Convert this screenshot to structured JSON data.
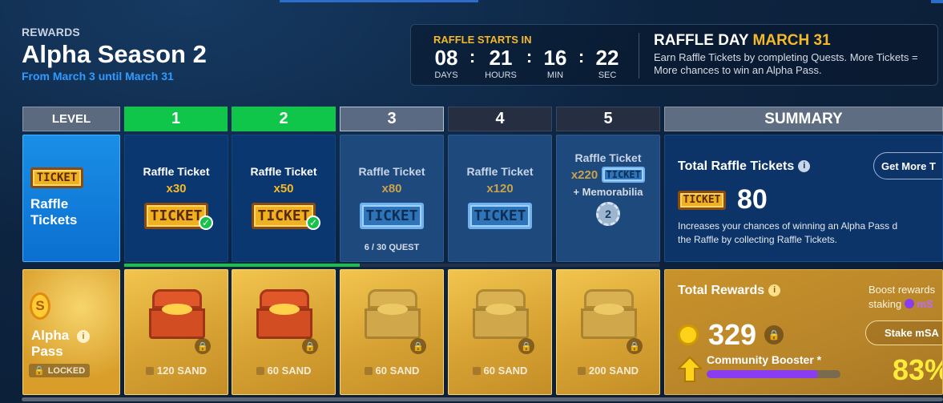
{
  "header": {
    "eyebrow": "REWARDS",
    "title": "Alpha Season 2",
    "subtitle": "From March 3 until March 31"
  },
  "timer": {
    "label": "RAFFLE STARTS IN",
    "days": "08",
    "days_label": "DAYS",
    "hours": "21",
    "hours_label": "HOURS",
    "minutes": "16",
    "minutes_label": "MIN",
    "seconds": "22",
    "seconds_label": "SEC",
    "separator": ":",
    "raffle_day_prefix": "RAFFLE DAY",
    "raffle_day_date": "MARCH 31",
    "raffle_desc": "Earn Raffle Tickets by completing Quests. More Tickets = More chances to win an Alpha Pass."
  },
  "columns": {
    "level_label": "LEVEL",
    "levels": [
      "1",
      "2",
      "3",
      "4",
      "5"
    ],
    "summary_label": "SUMMARY"
  },
  "raffle_row": {
    "label": "Raffle Tickets",
    "ticket_text": "TICKET",
    "cells": [
      {
        "title": "Raffle Ticket",
        "qty": "x30"
      },
      {
        "title": "Raffle Ticket",
        "qty": "x50"
      },
      {
        "title": "Raffle Ticket",
        "qty": "x80",
        "note": "6 / 30 QUEST"
      },
      {
        "title": "Raffle Ticket",
        "qty": "x120"
      },
      {
        "title": "Raffle Ticket",
        "qty": "x220",
        "extra": "+ Memorabilia",
        "medal": "2"
      }
    ],
    "summary": {
      "title": "Total Raffle Tickets",
      "button": "Get More T",
      "count": "80",
      "desc_1": "Increases your chances of winning an Alpha Pass d",
      "desc_2": "the Raffle by collecting Raffle Tickets."
    }
  },
  "progress": {
    "fraction": 0.44
  },
  "alpha_row": {
    "label_1": "Alpha",
    "label_2": "Pass",
    "coin_symbol": "S",
    "locked": "LOCKED",
    "cells": [
      {
        "sand": "120 SAND"
      },
      {
        "sand": "60 SAND"
      },
      {
        "sand": "60 SAND"
      },
      {
        "sand": "60 SAND"
      },
      {
        "sand": "200 SAND"
      }
    ],
    "summary": {
      "title": "Total Rewards",
      "boost_1": "Boost rewards",
      "boost_2": "staking",
      "boost_token": "mS",
      "stake_button": "Stake mSA",
      "amount": "329",
      "booster_title": "Community Booster *",
      "booster_fraction": 0.83,
      "percent": "83%"
    }
  },
  "icons": {
    "info": "info-icon",
    "lock": "lock-icon",
    "check": "check-icon"
  },
  "colors": {
    "accent": "#f5b928",
    "link": "#2f9bff",
    "done": "#10c64a",
    "booster": "#8a3df0"
  }
}
